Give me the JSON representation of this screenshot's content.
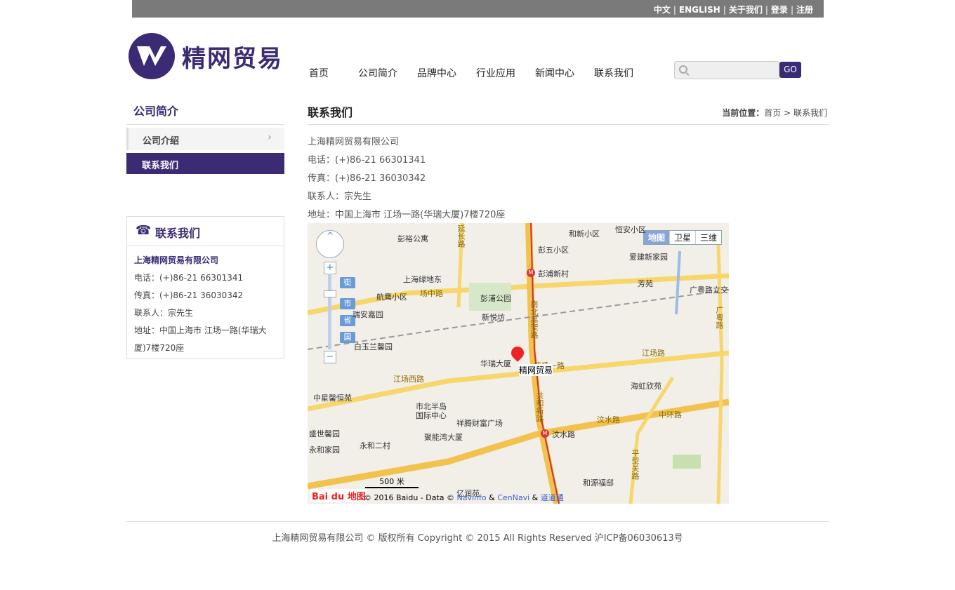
{
  "header": {
    "links": [
      "中文",
      "ENGLISH",
      "关于我们",
      "登录",
      "注册"
    ],
    "logo_text": "精网贸易",
    "nav": [
      "首页",
      "公司简介",
      "品牌中心",
      "行业应用",
      "新闻中心",
      "联系我们"
    ],
    "search": {
      "value": "",
      "placeholder": ""
    },
    "go_label": "GO"
  },
  "sidebar": {
    "title": "公司简介",
    "items": [
      {
        "label": "公司介绍",
        "active": false
      },
      {
        "label": "联系我们",
        "active": true
      }
    ],
    "contact": {
      "title": "联系我们",
      "company": "上海精网贸易有限公司",
      "phone": "电话：(+)86-21 66301341",
      "fax": "传真：(+)86-21 36030342",
      "person": "联系人：宗先生",
      "address": "地址：中国上海市 江场一路(华瑞大厦)7楼720座"
    }
  },
  "main": {
    "title": "联系我们",
    "breadcrumb": {
      "label": "当前位置：",
      "home": "首页",
      "sep": ">",
      "current": "联系我们"
    },
    "lines": [
      "上海精网贸易有限公司",
      "电话：(+)86-21 66301341",
      "传真：(+)86-21 36030342",
      "联系人：宗先生",
      "地址：中国上海市 江场一路(华瑞大厦)7楼720座"
    ]
  },
  "map": {
    "types": [
      "地图",
      "卫星",
      "三维"
    ],
    "zoom_levels": [
      "街",
      "市",
      "省",
      "国"
    ],
    "marker_label": "精网贸易",
    "scale": "500 米",
    "brand": "Bai du 地图",
    "copyright_prefix": "© 2016 Baidu - Data ©",
    "copyright_links": [
      "Navinfo",
      "CenNavi",
      "道道通"
    ],
    "labels": {
      "pengpu_xincun": "彭浦新村",
      "wenshui_lu": "汶水路",
      "huarui": "华瑞大厦",
      "pengpu_park": "彭浦公园",
      "xinyue": "新悦坊",
      "hangying": "航鹰小区",
      "shanghai_lvdi": "上海绿地东",
      "pengyu": "彭裕公寓",
      "hexin": "和新小区",
      "hengan": "恒安小区",
      "pengwu": "彭五小区",
      "aijian": "爱建新家园",
      "fangyuan": "芳苑",
      "guangyue": "广粤路立交",
      "shibeibandao": "市北半岛国际中心",
      "xiangteng": "祥腾财富广场",
      "juneng": "聚能湾大厦",
      "haihong": "海虹欣苑",
      "zhongxing": "中星馨恒苑",
      "shengshi": "盛世馨园",
      "yonghe_jiayuan": "永和家园",
      "yonghe_ercun": "永和二村",
      "heyuan": "和源福邸",
      "yirun": "亿润苑",
      "baiyulan": "白玉兰馨园",
      "ruian": "瑞安嘉园",
      "road_jiangchang_xi": "江场西路",
      "road_jiangchang": "江场路",
      "road_jiangchang_yi": "江场一路",
      "road_wenshui": "汶水路",
      "road_zhonghuan": "中环路",
      "road_gonghexin": "共和新路",
      "road_nanbei": "南北高架路",
      "road_guangyue": "广粤路",
      "road_pingxing": "平型关路",
      "road_changzhong": "场中路",
      "road_yanchang": "延长路"
    }
  },
  "footer": {
    "text": "上海精网贸易有限公司 © 版权所有 Copyright © 2015 All Rights Reserved 沪ICP备06030613号"
  }
}
